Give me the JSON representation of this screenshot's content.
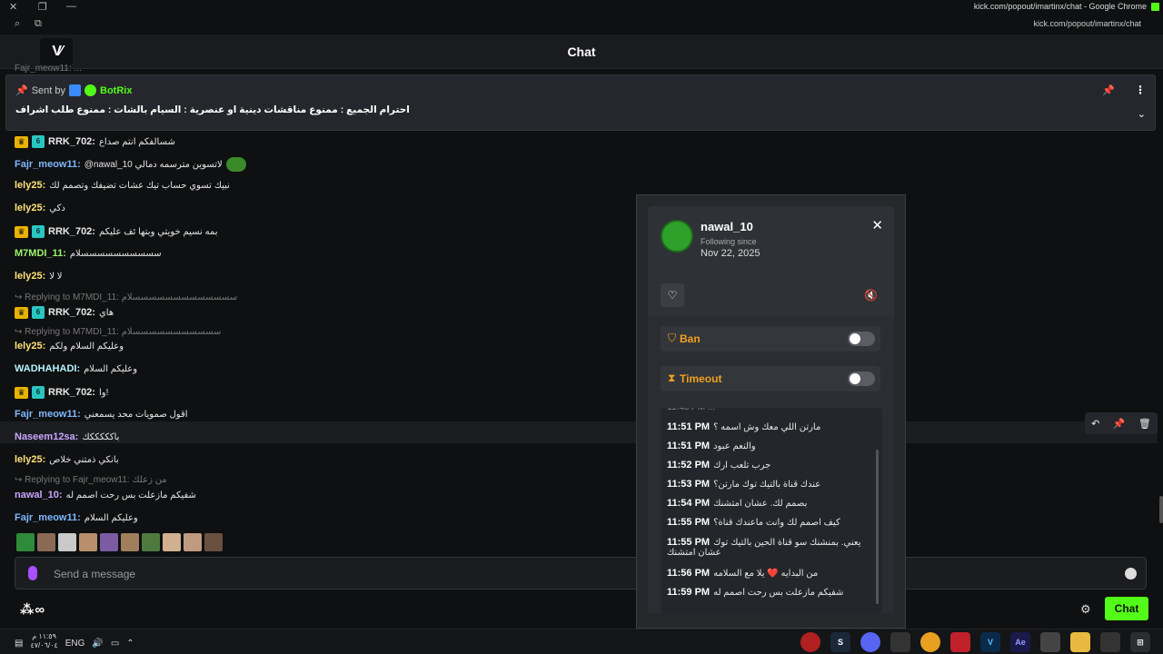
{
  "browser": {
    "window_title": "kick.com/popout/imartinx/chat - Google Chrome",
    "url": "kick.com/popout/imartinx/chat"
  },
  "header": {
    "logo_text": "V",
    "title": "Chat"
  },
  "cutoff_text": "Fajr_meow11: ...",
  "pinned": {
    "sent_by_label": "Sent by",
    "bot_name": "BotRix",
    "message": "احترام الجميع : ممنوع مناقشات دينية او عنصرية : السيام بالشات : ممنوع طلب اشراف"
  },
  "messages": [
    {
      "user": "RRK_702:",
      "color": "#e8e8e8",
      "badges": true,
      "text": "شسالفكم انتم صداع"
    },
    {
      "user": "Fajr_meow11:",
      "color": "#7eb8ff",
      "badges": false,
      "text": "@nawal_10 لاتسوين مترسمه دمالي",
      "pepe": true
    },
    {
      "user": "lely25:",
      "color": "#ffe27a",
      "badges": false,
      "text": "نبيك تسوي حساب تيك عشات تضيفك وتصمم لك"
    },
    {
      "user": "lely25:",
      "color": "#ffe27a",
      "badges": false,
      "text": "دكي"
    },
    {
      "user": "RRK_702:",
      "color": "#e8e8e8",
      "badges": true,
      "text": "بمه نسيم خويتي وبتها ئف عليكم"
    },
    {
      "user": "M7MDI_11:",
      "color": "#9cf56c",
      "badges": false,
      "text": "سسسسسسسسسسلام"
    },
    {
      "user": "lely25:",
      "color": "#ffe27a",
      "badges": false,
      "text": "لا لا"
    },
    {
      "reply": "Replying to M7MDI_11: سسسسسسسسسسسسسلام"
    },
    {
      "user": "RRK_702:",
      "color": "#e8e8e8",
      "badges": true,
      "text": "هاي"
    },
    {
      "reply": "Replying to M7MDI_11: سسسسسسسسسسسلام"
    },
    {
      "user": "lely25:",
      "color": "#ffe27a",
      "badges": false,
      "text": "وعليكم السلام ولكم"
    },
    {
      "user": "WADHAHADI:",
      "color": "#b6f3ff",
      "badges": false,
      "text": "وعليكم السلام"
    },
    {
      "user": "RRK_702:",
      "color": "#e8e8e8",
      "badges": true,
      "text": "وا!"
    },
    {
      "user": "Fajr_meow11:",
      "color": "#7eb8ff",
      "badges": false,
      "text": "اقول صمويات محد يسمعني"
    },
    {
      "user": "Naseem12sa:",
      "color": "#c9a7ff",
      "badges": false,
      "text": "باكككككك"
    },
    {
      "user": "lely25:",
      "color": "#ffe27a",
      "badges": false,
      "text": "بانكي ذمتني خلاص"
    },
    {
      "reply": "Replying to Fajr_meow11: من زعلك"
    },
    {
      "user": "nawal_10:",
      "color": "#c9a7ff",
      "badges": false,
      "text": "شفيكم مازعلت بس رحت اصمم له"
    },
    {
      "user": "Fajr_meow11:",
      "color": "#7eb8ff",
      "badges": false,
      "text": "وعليكم السلام"
    }
  ],
  "input": {
    "placeholder": "Send a message"
  },
  "send_label": "Chat",
  "user_card": {
    "username": "nawal_10",
    "following_label": "Following since",
    "following_date": "Nov 22, 2025",
    "ban_label": "Ban",
    "timeout_label": "Timeout",
    "history": [
      {
        "time": "11:51 PM",
        "text": "مارتن اللي معك وش اسمه ؟"
      },
      {
        "time": "11:51 PM",
        "text": "والنعم عبود"
      },
      {
        "time": "11:52 PM",
        "text": "جرب تلعب ارك"
      },
      {
        "time": "11:53 PM",
        "text": "عندك قناة بالتيك توك مارتن؟"
      },
      {
        "time": "11:54 PM",
        "text": "بصمم لك. عشان امتشنك"
      },
      {
        "time": "11:55 PM",
        "text": "كيف اصمم لك وانت ماعندك قناة؟"
      },
      {
        "time": "11:55 PM",
        "text": "يعني. بمنشنك سو قناة الحين بالتيك توك"
      },
      {
        "time": "",
        "text": "عشان امتشنك"
      },
      {
        "time": "11:56 PM",
        "text": "من البدايه ❤️ يلا مع السلامه"
      },
      {
        "time": "11:59 PM",
        "text": "شفيكم مازعلت بس رحت اصمم له"
      }
    ]
  },
  "taskbar": {
    "lang": "ENG",
    "time": "١١:٥٩ م",
    "date": "٤٧/٠٦/٠٤"
  },
  "colors": {
    "kick_green": "#53fc18",
    "mod_orange": "#f0a020",
    "background": "#0f1011"
  }
}
